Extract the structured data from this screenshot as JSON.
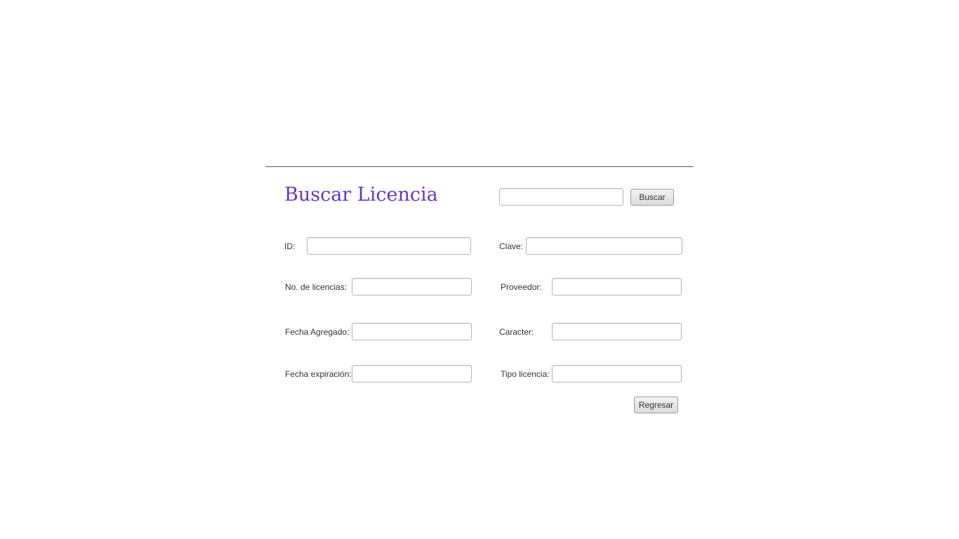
{
  "header": {
    "title": "Buscar Licencia",
    "search": {
      "value": "",
      "placeholder": "",
      "button_label": "Buscar"
    }
  },
  "form": {
    "id": {
      "label": "ID:",
      "value": ""
    },
    "clave": {
      "label": "Clave:",
      "value": ""
    },
    "no_licencias": {
      "label": "No. de licencias:",
      "value": ""
    },
    "proveedor": {
      "label": "Proveedor:",
      "value": ""
    },
    "fecha_agregado": {
      "label": "Fecha Agregado:",
      "value": ""
    },
    "caracter": {
      "label": "Caracter:",
      "value": ""
    },
    "fecha_expiracion": {
      "label": "Fecha expiración:",
      "value": ""
    },
    "tipo_licencia": {
      "label": "Tipo licencia:",
      "value": ""
    }
  },
  "actions": {
    "back_label": "Regresar"
  },
  "colors": {
    "title": "#6a35c9",
    "divider": "#5a5a5a",
    "background": "#ffffff"
  }
}
